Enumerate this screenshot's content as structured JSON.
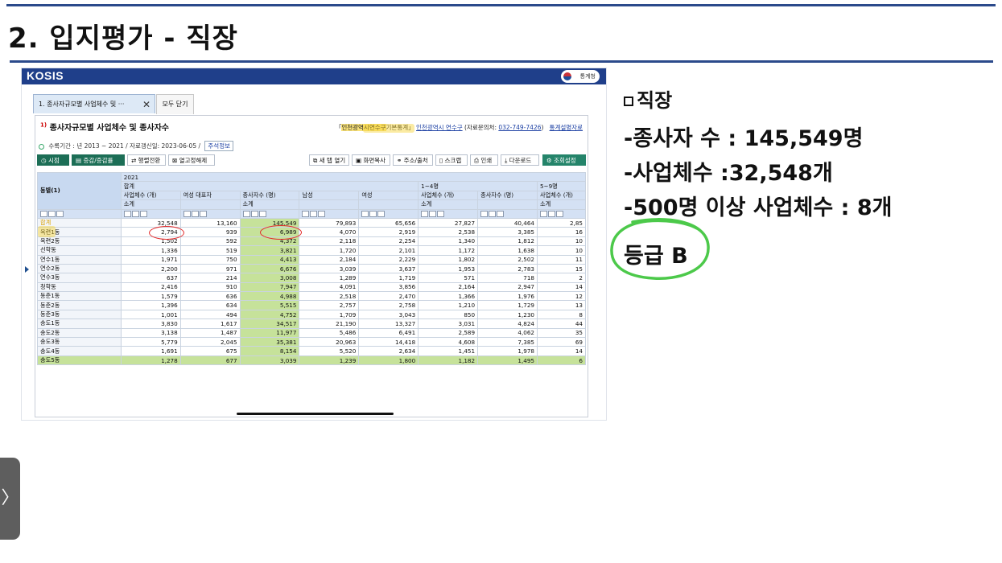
{
  "slide": {
    "title": "2. 입지평가 - 직장",
    "nav_arrow": "〉"
  },
  "kosis": {
    "logo": "KOSIS",
    "org": "통계청",
    "tabs": [
      {
        "label": "1. 종사자규모별 사업체수 및 ···",
        "close": "✕"
      },
      {
        "label": "모두 닫기"
      }
    ],
    "table_title": "종사자규모별 사업체수 및 종사자수",
    "title_superscript": "1)",
    "source": {
      "pre": "「",
      "highlight": "인천광역시연수구",
      "post": "기본통계」",
      "office": "인천광역시 연수구",
      "contact_label": "(자료문의처:",
      "phone": "032-749-7426",
      "contact_end": ")",
      "link": "통계설명자료"
    },
    "meta": {
      "period": "수록기간 : 년 2013 ~ 2021 / 자료갱신일: 2023-06-05 /",
      "memo_button": "주석정보"
    },
    "toolbar": {
      "point_in_time": "시점",
      "increase_rate": "증감/증감률",
      "transpose": "행렬전환",
      "unfix_column": "열고정해제",
      "new_window": "새 탭 열기",
      "screen_copy": "화면복사",
      "url_source": "주소/출처",
      "scrap": "스크랩",
      "print": "인쇄",
      "download": "다운로드",
      "settings": "조회설정"
    },
    "grid": {
      "stub_header": "동별(1)",
      "year": "2021",
      "groups": [
        "합계",
        "1~4명",
        "5~9명"
      ],
      "subgroups": [
        "사업체수 (개)",
        "여성 대표자",
        "종사자수 (명)",
        "남성",
        "여성",
        "사업체수 (개)",
        "종사자수 (명)",
        "사업체수 (개)"
      ],
      "leaf_headers": [
        "소계",
        "소계",
        "소계",
        "소계"
      ],
      "rows": [
        [
          "합계",
          "32,548",
          "13,160",
          "145,549",
          "79,893",
          "65,656",
          "27,827",
          "40,464",
          "2,85"
        ],
        [
          "옥련1동",
          "2,794",
          "939",
          "6,989",
          "4,070",
          "2,919",
          "2,538",
          "3,385",
          "16"
        ],
        [
          "옥련2동",
          "1,502",
          "592",
          "4,372",
          "2,118",
          "2,254",
          "1,340",
          "1,812",
          "10"
        ],
        [
          "선학동",
          "1,336",
          "519",
          "3,821",
          "1,720",
          "2,101",
          "1,172",
          "1,638",
          "10"
        ],
        [
          "연수1동",
          "1,971",
          "750",
          "4,413",
          "2,184",
          "2,229",
          "1,802",
          "2,502",
          "11"
        ],
        [
          "연수2동",
          "2,200",
          "971",
          "6,676",
          "3,039",
          "3,637",
          "1,953",
          "2,783",
          "15"
        ],
        [
          "연수3동",
          "637",
          "214",
          "3,008",
          "1,289",
          "1,719",
          "571",
          "718",
          "2"
        ],
        [
          "청학동",
          "2,416",
          "910",
          "7,947",
          "4,091",
          "3,856",
          "2,164",
          "2,947",
          "14"
        ],
        [
          "동춘1동",
          "1,579",
          "636",
          "4,988",
          "2,518",
          "2,470",
          "1,366",
          "1,976",
          "12"
        ],
        [
          "동춘2동",
          "1,396",
          "634",
          "5,515",
          "2,757",
          "2,758",
          "1,210",
          "1,729",
          "13"
        ],
        [
          "동춘3동",
          "1,001",
          "494",
          "4,752",
          "1,709",
          "3,043",
          "850",
          "1,230",
          "8"
        ],
        [
          "송도1동",
          "3,830",
          "1,617",
          "34,517",
          "21,190",
          "13,327",
          "3,031",
          "4,824",
          "44"
        ],
        [
          "송도2동",
          "3,138",
          "1,487",
          "11,977",
          "5,486",
          "6,491",
          "2,589",
          "4,062",
          "35"
        ],
        [
          "송도3동",
          "5,779",
          "2,045",
          "35,381",
          "20,963",
          "14,418",
          "4,608",
          "7,385",
          "69"
        ],
        [
          "송도4동",
          "1,691",
          "675",
          "8,154",
          "5,520",
          "2,634",
          "1,451",
          "1,978",
          "14"
        ],
        [
          "송도5동",
          "1,278",
          "677",
          "3,039",
          "1,239",
          "1,800",
          "1,182",
          "1,495",
          "6"
        ]
      ]
    }
  },
  "notes": {
    "heading": "직장",
    "lines": [
      {
        "pre": "-종사자 수 : ",
        "value": "145,549",
        "post": "명"
      },
      {
        "pre": "-사업체수 :",
        "value": "32,548",
        "post": "개"
      },
      {
        "pre": "-500명 이상 사업체수 : ",
        "value": "8",
        "post": "개"
      }
    ],
    "grade": "등급 B"
  },
  "colors": {
    "brand_blue": "#1f3f8a",
    "highlight_green": "#c6e29a",
    "annotation_red": "#e32b2b",
    "grade_circle_green": "#4cc94a"
  }
}
